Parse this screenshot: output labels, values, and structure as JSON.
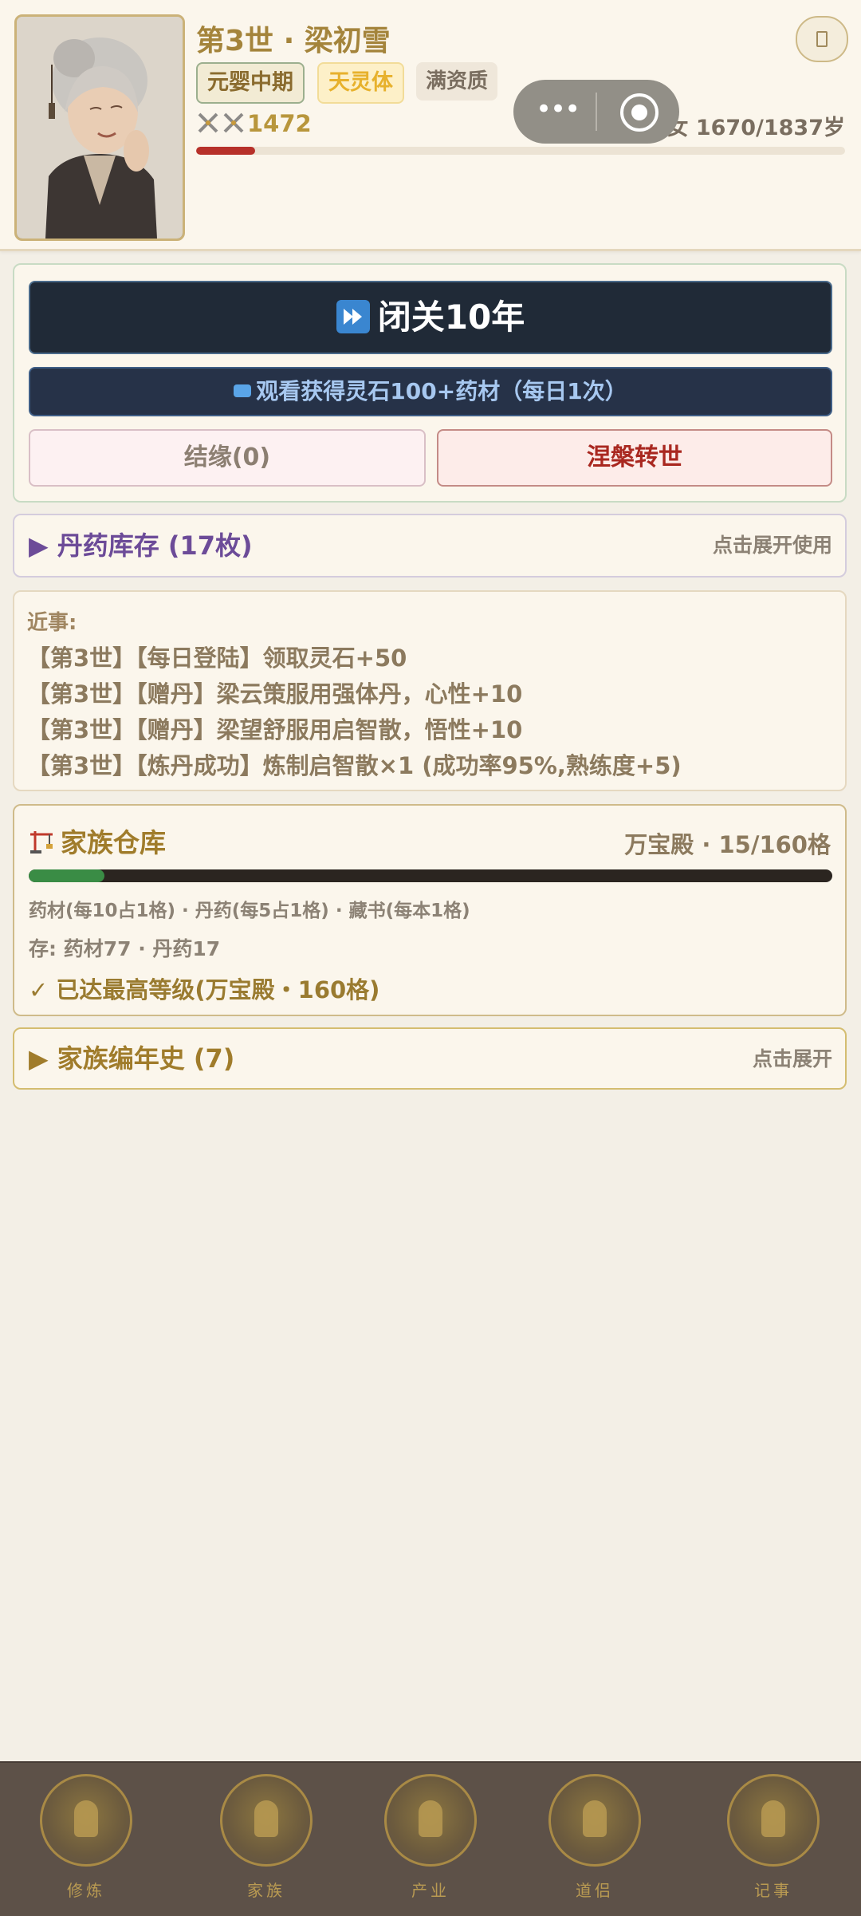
{
  "header": {
    "name_line": "第3世 · 梁初雪",
    "realm_tag": "元婴中期",
    "body_tag": "天灵体",
    "aptitude_tag": "满资质",
    "power_value": "1472",
    "age_text": "女 1670/1837岁",
    "lifespan_fraction": 0.0909
  },
  "actions": {
    "retreat_label": "闭关10年",
    "ad_label": "观看获得灵石100+药材（每日1次）",
    "bond_label": "结缘(0)",
    "rebirth_label": "涅槃转世"
  },
  "pills": {
    "title": "▶ 丹药库存 (17枚)",
    "hint": "点击展开使用"
  },
  "events": {
    "label": "近事:",
    "lines": [
      "【第3世】【每日登陆】领取灵石+50",
      "【第3世】【赠丹】梁云策服用强体丹，心性+10",
      "【第3世】【赠丹】梁望舒服用启智散，悟性+10",
      "【第3世】【炼丹成功】炼制启智散×1 (成功率95%,熟练度+5)"
    ]
  },
  "warehouse": {
    "title": "家族仓库",
    "capacity": "万宝殿 · 15/160格",
    "fill_fraction": 0.09375,
    "rules": "药材(每10占1格) · 丹药(每5占1格) · 藏书(每本1格)",
    "stock": "存: 药材77 · 丹药17",
    "max_level": "✓ 已达最高等级(万宝殿・160格)"
  },
  "chronicle": {
    "title": "▶ 家族编年史 (7)",
    "hint": "点击展开"
  },
  "bottom_nav": {
    "items": [
      {
        "label": "修炼",
        "icon": "meditation-icon"
      },
      {
        "label": "家族",
        "icon": "pavilion-icon"
      },
      {
        "label": "产业",
        "icon": "mountain-icon"
      },
      {
        "label": "道侣",
        "icon": "couple-icon"
      },
      {
        "label": "记事",
        "icon": "scroll-icon"
      }
    ]
  },
  "colors": {
    "accent_gold": "#a4843b",
    "primary_dark": "#202a37",
    "rebirth_red": "#a92820",
    "pill_purple": "#6c4b98",
    "life_red": "#b7312a",
    "storage_green": "#3a8c45"
  }
}
